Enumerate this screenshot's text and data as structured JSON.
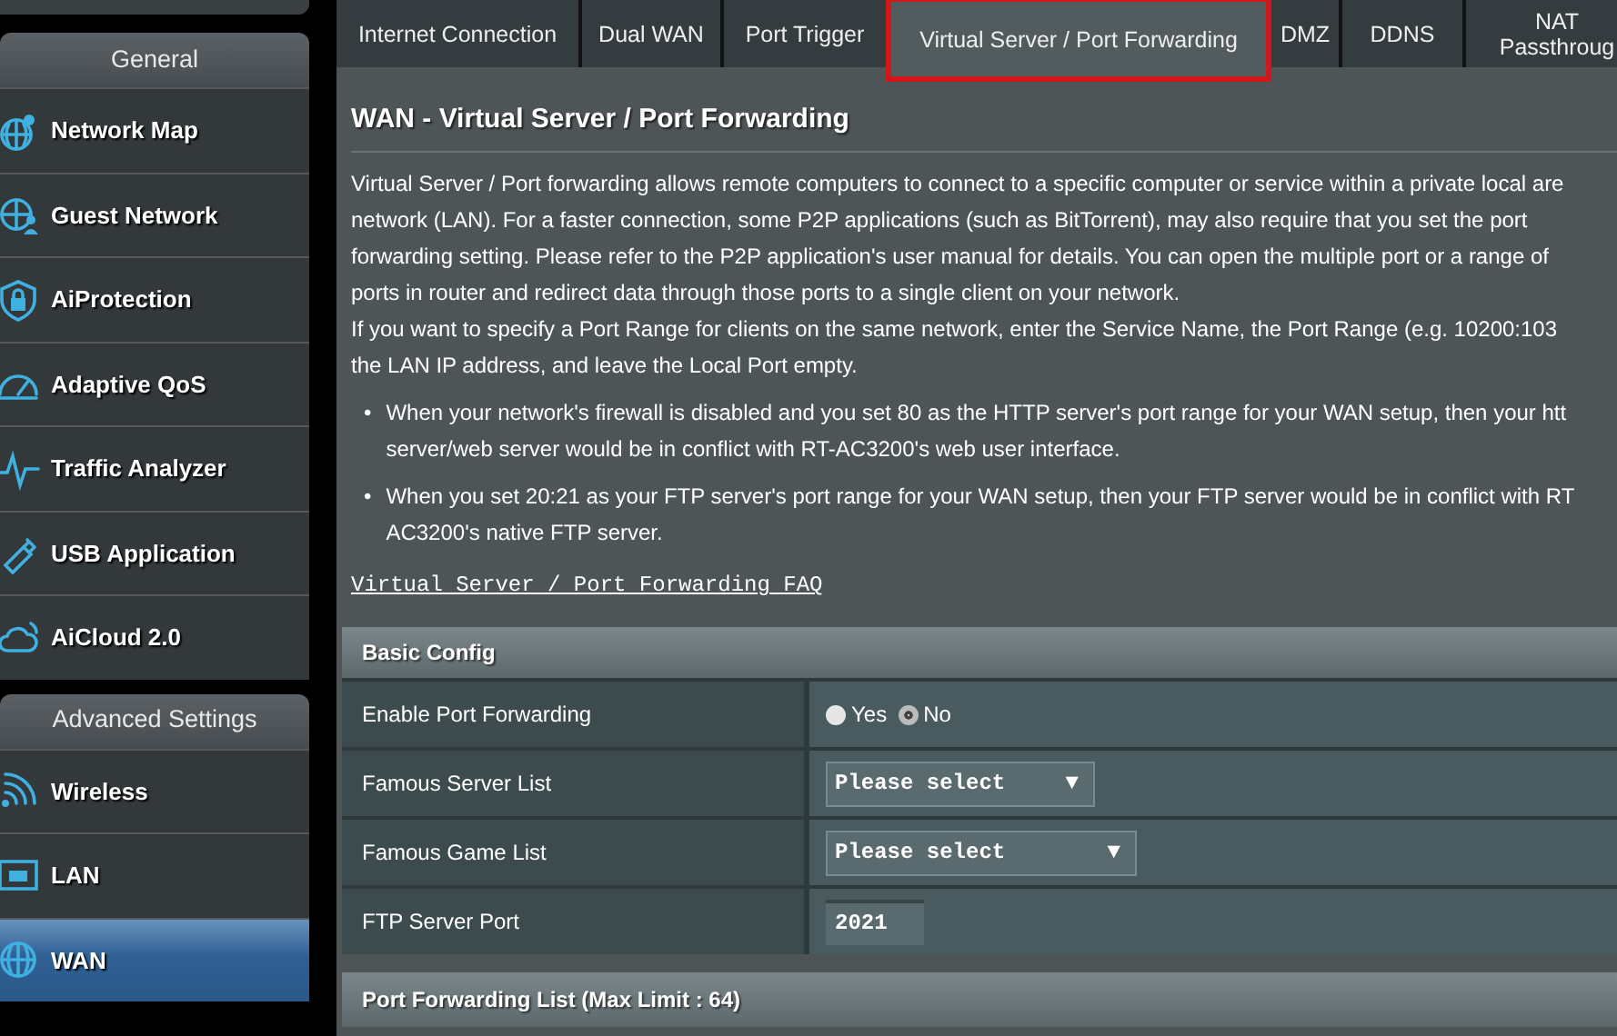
{
  "sidebar": {
    "sections": [
      {
        "title": "General",
        "items": [
          {
            "label": "Network Map",
            "selected": false
          },
          {
            "label": "Guest Network",
            "selected": false
          },
          {
            "label": "AiProtection",
            "selected": false
          },
          {
            "label": "Adaptive QoS",
            "selected": false
          },
          {
            "label": "Traffic Analyzer",
            "selected": false
          },
          {
            "label": "USB Application",
            "selected": false
          },
          {
            "label": "AiCloud 2.0",
            "selected": false
          }
        ]
      },
      {
        "title": "Advanced Settings",
        "items": [
          {
            "label": "Wireless",
            "selected": false
          },
          {
            "label": "LAN",
            "selected": false
          },
          {
            "label": "WAN",
            "selected": true
          }
        ]
      }
    ]
  },
  "tabs": [
    {
      "label": "Internet Connection",
      "selected": false
    },
    {
      "label": "Dual WAN",
      "selected": false
    },
    {
      "label": "Port Trigger",
      "selected": false
    },
    {
      "label": "Virtual Server / Port Forwarding",
      "selected": true
    },
    {
      "label": "DMZ",
      "selected": false
    },
    {
      "label": "DDNS",
      "selected": false
    },
    {
      "label": "NAT Passthroug",
      "selected": false
    }
  ],
  "page_title": "WAN - Virtual Server / Port Forwarding",
  "description_lines": [
    "Virtual Server / Port forwarding allows remote computers to connect to a specific computer or service within a private local are",
    "network (LAN). For a faster connection, some P2P applications (such as BitTorrent), may also require that you set the port",
    "forwarding setting. Please refer to the P2P application's user manual for details. You can open the multiple port or a range of",
    "ports in router and redirect data through those ports to a single client on your network.",
    "If you want to specify a Port Range for clients on the same network, enter the Service Name, the Port Range (e.g. 10200:103",
    "the LAN IP address, and leave the Local Port empty."
  ],
  "notes": [
    {
      "bullet": "•",
      "lines": [
        "When your network's firewall is disabled and you set 80 as the HTTP server's port range for your WAN setup, then your htt",
        "server/web server would be in conflict with RT-AC3200's web user interface."
      ]
    },
    {
      "bullet": "•",
      "lines": [
        "When you set 20:21 as your FTP server's port range for your WAN setup, then your FTP server would be in conflict with RT",
        "AC3200's native FTP server."
      ]
    }
  ],
  "faq_link": "Virtual Server / Port Forwarding FAQ",
  "basic_config": {
    "title": "Basic Config",
    "rows": [
      {
        "kind": "radio",
        "label": "Enable Port Forwarding",
        "options": [
          {
            "label": "Yes",
            "selected": false
          },
          {
            "label": "No",
            "selected": true
          }
        ]
      },
      {
        "kind": "select",
        "label": "Famous Server List",
        "value": "Please select",
        "caret": "▼"
      },
      {
        "kind": "select",
        "label": "Famous Game List",
        "value": "Please select",
        "caret": "▼"
      },
      {
        "kind": "input",
        "label": "FTP Server Port",
        "value": "2021"
      }
    ]
  },
  "port_forwarding_list": {
    "title": "Port Forwarding List (Max Limit : 64)"
  }
}
